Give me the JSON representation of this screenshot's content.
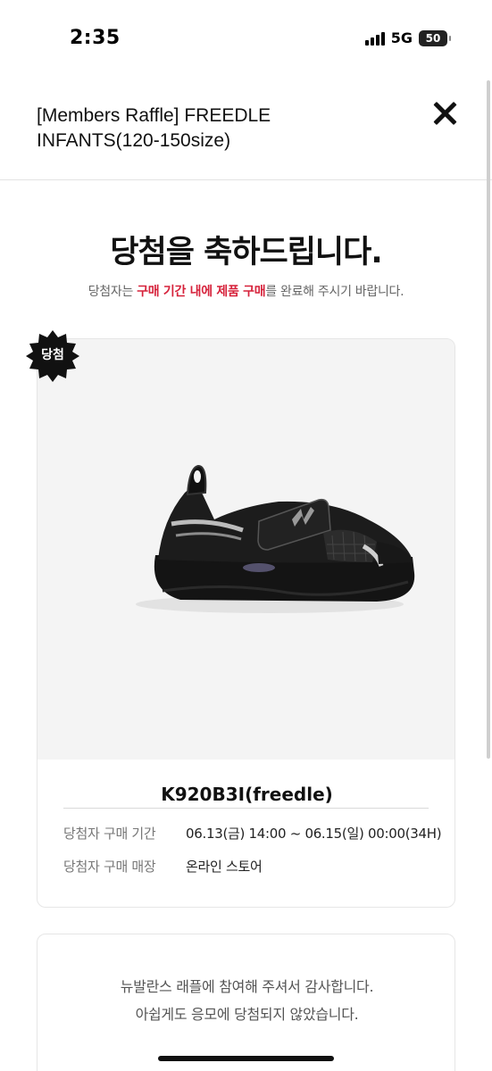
{
  "status_bar": {
    "time": "2:35",
    "network": "5G",
    "battery": "50"
  },
  "header": {
    "title": "[Members Raffle] FREEDLE INFANTS(120-150size)",
    "close_icon": "close-icon"
  },
  "result": {
    "heading": "당첨을 축하드립니다.",
    "sub_prefix": "당첨자는 ",
    "sub_highlight": "구매 기간 내에 제품 구매",
    "sub_suffix": "를 완료해 주시기 바랍니다."
  },
  "product": {
    "badge": "당첨",
    "name": "K920B3I(freedle)",
    "image_icon": "shoe-image",
    "info": [
      {
        "label": "당첨자 구매 기간",
        "value": "06.13(금) 14:00 ~ 06.15(일) 00:00(34H)"
      },
      {
        "label": "당첨자 구매 매장",
        "value": "온라인 스토어"
      }
    ]
  },
  "notice": {
    "line1": "뉴발란스 래플에 참여해 주셔서 감사합니다.",
    "line2": "아쉽게도 응모에 당첨되지 않았습니다."
  },
  "colors": {
    "accent": "#d6223b",
    "badge": "#111111"
  }
}
